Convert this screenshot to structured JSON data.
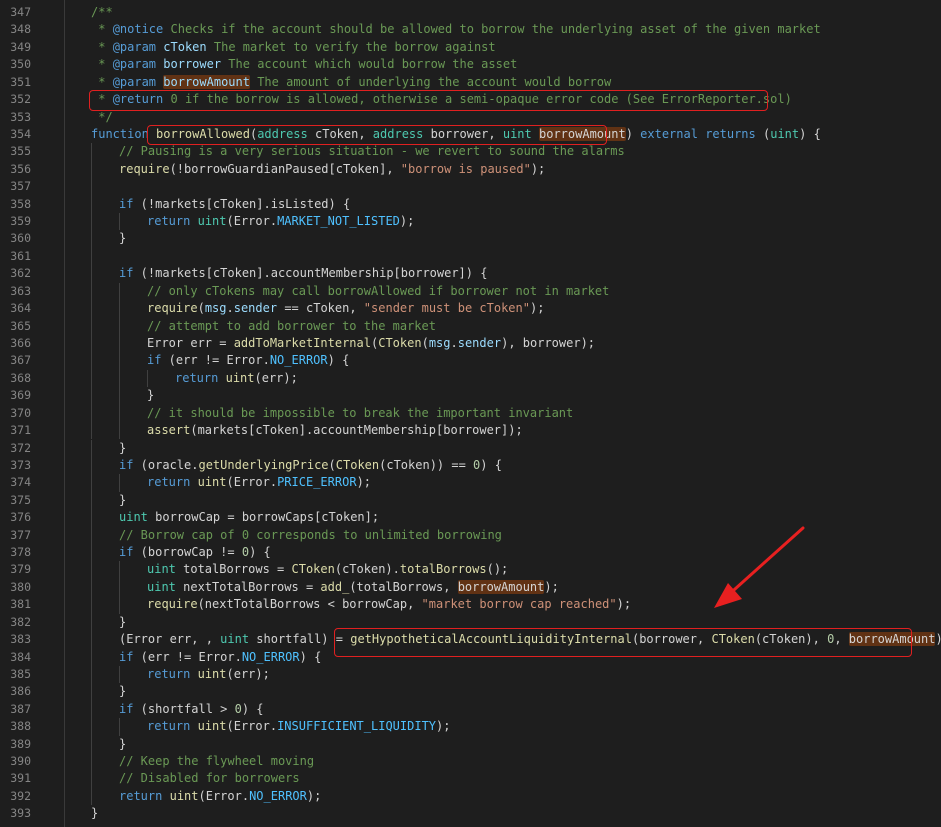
{
  "editor": {
    "lines": [
      {
        "n": "347",
        "indent": 0,
        "tokens": [
          [
            "/**",
            "cm"
          ]
        ]
      },
      {
        "n": "348",
        "indent": 0,
        "tokens": [
          [
            " * ",
            "cm"
          ],
          [
            "@notice",
            "tg"
          ],
          [
            " Checks if the account should be allowed to borrow the underlying asset of the given market",
            "cm"
          ]
        ]
      },
      {
        "n": "349",
        "indent": 0,
        "tokens": [
          [
            " * ",
            "cm"
          ],
          [
            "@param",
            "tg"
          ],
          [
            " ",
            "cm"
          ],
          [
            "cToken",
            "va"
          ],
          [
            " The market to verify the borrow against",
            "cm"
          ]
        ]
      },
      {
        "n": "350",
        "indent": 0,
        "tokens": [
          [
            " * ",
            "cm"
          ],
          [
            "@param",
            "tg"
          ],
          [
            " ",
            "cm"
          ],
          [
            "borrower",
            "va"
          ],
          [
            " The account which would borrow the asset",
            "cm"
          ]
        ]
      },
      {
        "n": "351",
        "indent": 0,
        "tokens": [
          [
            " * ",
            "cm"
          ],
          [
            "@param",
            "tg"
          ],
          [
            " ",
            "cm"
          ],
          [
            "borrowAmount",
            "va hl"
          ],
          [
            " The amount of underlying the account would borrow",
            "cm"
          ]
        ]
      },
      {
        "n": "352",
        "indent": 0,
        "tokens": [
          [
            " * ",
            "cm"
          ],
          [
            "@return",
            "tg"
          ],
          [
            " 0 if the borrow is allowed, otherwise a semi-opaque error code (See ErrorReporter.sol)",
            "cm"
          ]
        ]
      },
      {
        "n": "353",
        "indent": 0,
        "tokens": [
          [
            " */",
            "cm"
          ]
        ]
      },
      {
        "n": "354",
        "indent": 0,
        "tokens": [
          [
            "function ",
            "kw"
          ],
          [
            "borrowAllowed",
            "fn"
          ],
          [
            "(",
            ""
          ],
          [
            "address",
            "ty"
          ],
          [
            " cToken, ",
            ""
          ],
          [
            "address",
            "ty"
          ],
          [
            " borrower, ",
            ""
          ],
          [
            "uint",
            "ty"
          ],
          [
            " ",
            ""
          ],
          [
            "borrowAmount",
            "hl"
          ],
          [
            ") ",
            ""
          ],
          [
            "external",
            "kw"
          ],
          [
            " ",
            ""
          ],
          [
            "returns",
            "kw"
          ],
          [
            " (",
            ""
          ],
          [
            "uint",
            "ty"
          ],
          [
            ") {",
            ""
          ]
        ]
      },
      {
        "n": "355",
        "indent": 1,
        "tokens": [
          [
            "// Pausing is a very serious situation - we revert to sound the alarms",
            "cm"
          ]
        ]
      },
      {
        "n": "356",
        "indent": 1,
        "tokens": [
          [
            "require",
            "fn"
          ],
          [
            "(!borrowGuardianPaused[cToken], ",
            ""
          ],
          [
            "\"borrow is paused\"",
            "st"
          ],
          [
            ");",
            ""
          ]
        ]
      },
      {
        "n": "357",
        "indent": 1,
        "tokens": []
      },
      {
        "n": "358",
        "indent": 1,
        "tokens": [
          [
            "if",
            "kw"
          ],
          [
            " (!markets[cToken].isListed) {",
            ""
          ]
        ]
      },
      {
        "n": "359",
        "indent": 2,
        "tokens": [
          [
            "return",
            "kw"
          ],
          [
            " ",
            ""
          ],
          [
            "uint",
            "ty"
          ],
          [
            "(Error.",
            ""
          ],
          [
            "MARKET_NOT_LISTED",
            "cn"
          ],
          [
            ");",
            ""
          ]
        ]
      },
      {
        "n": "360",
        "indent": 1,
        "tokens": [
          [
            "}",
            ""
          ]
        ]
      },
      {
        "n": "361",
        "indent": 1,
        "tokens": []
      },
      {
        "n": "362",
        "indent": 1,
        "tokens": [
          [
            "if",
            "kw"
          ],
          [
            " (!markets[cToken].accountMembership[borrower]) {",
            ""
          ]
        ]
      },
      {
        "n": "363",
        "indent": 2,
        "tokens": [
          [
            "// only cTokens may call borrowAllowed if borrower not in market",
            "cm"
          ]
        ]
      },
      {
        "n": "364",
        "indent": 2,
        "tokens": [
          [
            "require",
            "fn"
          ],
          [
            "(",
            ""
          ],
          [
            "msg",
            "va"
          ],
          [
            ".",
            ""
          ],
          [
            "sender",
            "va"
          ],
          [
            " == cToken, ",
            ""
          ],
          [
            "\"sender must be cToken\"",
            "st"
          ],
          [
            ");",
            ""
          ]
        ]
      },
      {
        "n": "365",
        "indent": 2,
        "tokens": [
          [
            "// attempt to add borrower to the market",
            "cm"
          ]
        ]
      },
      {
        "n": "366",
        "indent": 2,
        "tokens": [
          [
            "Error err = ",
            ""
          ],
          [
            "addToMarketInternal",
            "fn"
          ],
          [
            "(",
            ""
          ],
          [
            "CToken",
            "fn"
          ],
          [
            "(",
            ""
          ],
          [
            "msg",
            "va"
          ],
          [
            ".",
            ""
          ],
          [
            "sender",
            "va"
          ],
          [
            "), borrower);",
            ""
          ]
        ]
      },
      {
        "n": "367",
        "indent": 2,
        "tokens": [
          [
            "if",
            "kw"
          ],
          [
            " (err != Error.",
            ""
          ],
          [
            "NO_ERROR",
            "cn"
          ],
          [
            ") {",
            ""
          ]
        ]
      },
      {
        "n": "368",
        "indent": 3,
        "tokens": [
          [
            "return",
            "kw"
          ],
          [
            " ",
            ""
          ],
          [
            "uint",
            "fn"
          ],
          [
            "(err);",
            ""
          ]
        ]
      },
      {
        "n": "369",
        "indent": 2,
        "tokens": [
          [
            "}",
            ""
          ]
        ]
      },
      {
        "n": "370",
        "indent": 2,
        "tokens": [
          [
            "// it should be impossible to break the important invariant",
            "cm"
          ]
        ]
      },
      {
        "n": "371",
        "indent": 2,
        "tokens": [
          [
            "assert",
            "fn"
          ],
          [
            "(markets[cToken].accountMembership[borrower]);",
            ""
          ]
        ]
      },
      {
        "n": "372",
        "indent": 1,
        "tokens": [
          [
            "}",
            ""
          ]
        ]
      },
      {
        "n": "373",
        "indent": 1,
        "tokens": [
          [
            "if",
            "kw"
          ],
          [
            " (oracle.",
            ""
          ],
          [
            "getUnderlyingPrice",
            "fn"
          ],
          [
            "(",
            ""
          ],
          [
            "CToken",
            "fn"
          ],
          [
            "(cToken)) == ",
            ""
          ],
          [
            "0",
            "nm"
          ],
          [
            ") {",
            ""
          ]
        ]
      },
      {
        "n": "374",
        "indent": 2,
        "tokens": [
          [
            "return",
            "kw"
          ],
          [
            " ",
            ""
          ],
          [
            "uint",
            "fn"
          ],
          [
            "(Error.",
            ""
          ],
          [
            "PRICE_ERROR",
            "cn"
          ],
          [
            ");",
            ""
          ]
        ]
      },
      {
        "n": "375",
        "indent": 1,
        "tokens": [
          [
            "}",
            ""
          ]
        ]
      },
      {
        "n": "376",
        "indent": 1,
        "tokens": [
          [
            "uint",
            "ty"
          ],
          [
            " borrowCap = borrowCaps[cToken];",
            ""
          ]
        ]
      },
      {
        "n": "377",
        "indent": 1,
        "tokens": [
          [
            "// Borrow cap of 0 corresponds to unlimited borrowing",
            "cm"
          ]
        ]
      },
      {
        "n": "378",
        "indent": 1,
        "tokens": [
          [
            "if",
            "kw"
          ],
          [
            " (borrowCap != ",
            ""
          ],
          [
            "0",
            "nm"
          ],
          [
            ") {",
            ""
          ]
        ]
      },
      {
        "n": "379",
        "indent": 2,
        "tokens": [
          [
            "uint",
            "ty"
          ],
          [
            " totalBorrows = ",
            ""
          ],
          [
            "CToken",
            "fn"
          ],
          [
            "(cToken).",
            ""
          ],
          [
            "totalBorrows",
            "fn"
          ],
          [
            "();",
            ""
          ]
        ]
      },
      {
        "n": "380",
        "indent": 2,
        "tokens": [
          [
            "uint",
            "ty"
          ],
          [
            " nextTotalBorrows = ",
            ""
          ],
          [
            "add_",
            "fn"
          ],
          [
            "(totalBorrows, ",
            ""
          ],
          [
            "borrowAmount",
            "hl"
          ],
          [
            ");",
            ""
          ]
        ]
      },
      {
        "n": "381",
        "indent": 2,
        "tokens": [
          [
            "require",
            "fn"
          ],
          [
            "(nextTotalBorrows < borrowCap, ",
            ""
          ],
          [
            "\"market borrow cap reached\"",
            "st"
          ],
          [
            ");",
            ""
          ]
        ]
      },
      {
        "n": "382",
        "indent": 1,
        "tokens": [
          [
            "}",
            ""
          ]
        ]
      },
      {
        "n": "383",
        "indent": 1,
        "tokens": [
          [
            "(Error err, , ",
            ""
          ],
          [
            "uint",
            "ty"
          ],
          [
            " shortfall) = ",
            ""
          ],
          [
            "getHypotheticalAccountLiquidityInternal",
            "fn"
          ],
          [
            "(borrower, ",
            ""
          ],
          [
            "CToken",
            "fn"
          ],
          [
            "(cToken), ",
            ""
          ],
          [
            "0",
            "nm"
          ],
          [
            ", ",
            ""
          ],
          [
            "borrowAmount",
            "hl"
          ],
          [
            ");",
            ""
          ]
        ]
      },
      {
        "n": "384",
        "indent": 1,
        "tokens": [
          [
            "if",
            "kw"
          ],
          [
            " (err != Error.",
            ""
          ],
          [
            "NO_ERROR",
            "cn"
          ],
          [
            ") {",
            ""
          ]
        ]
      },
      {
        "n": "385",
        "indent": 2,
        "tokens": [
          [
            "return",
            "kw"
          ],
          [
            " ",
            ""
          ],
          [
            "uint",
            "fn"
          ],
          [
            "(err);",
            ""
          ]
        ]
      },
      {
        "n": "386",
        "indent": 1,
        "tokens": [
          [
            "}",
            ""
          ]
        ]
      },
      {
        "n": "387",
        "indent": 1,
        "tokens": [
          [
            "if",
            "kw"
          ],
          [
            " (shortfall > ",
            ""
          ],
          [
            "0",
            "nm"
          ],
          [
            ") {",
            ""
          ]
        ]
      },
      {
        "n": "388",
        "indent": 2,
        "tokens": [
          [
            "return",
            "kw"
          ],
          [
            " ",
            ""
          ],
          [
            "uint",
            "fn"
          ],
          [
            "(Error.",
            ""
          ],
          [
            "INSUFFICIENT_LIQUIDITY",
            "cn"
          ],
          [
            ");",
            ""
          ]
        ]
      },
      {
        "n": "389",
        "indent": 1,
        "tokens": [
          [
            "}",
            ""
          ]
        ]
      },
      {
        "n": "390",
        "indent": 1,
        "tokens": [
          [
            "// Keep the flywheel moving",
            "cm"
          ]
        ]
      },
      {
        "n": "391",
        "indent": 1,
        "tokens": [
          [
            "// Disabled for borrowers",
            "cm"
          ]
        ]
      },
      {
        "n": "392",
        "indent": 1,
        "tokens": [
          [
            "return",
            "kw"
          ],
          [
            " ",
            ""
          ],
          [
            "uint",
            "fn"
          ],
          [
            "(Error.",
            ""
          ],
          [
            "NO_ERROR",
            "cn"
          ],
          [
            ");",
            ""
          ]
        ]
      },
      {
        "n": "393",
        "indent": 0,
        "tokens": [
          [
            "}",
            ""
          ]
        ]
      }
    ]
  },
  "annotations": {
    "box_color": "#e02020",
    "arrow_color": "#e82020",
    "boxes": [
      {
        "line": "352",
        "label": "return-doc"
      },
      {
        "line": "354",
        "label": "borrow-allowed-signature"
      },
      {
        "line": "383",
        "label": "hypothetical-liquidity-call"
      }
    ]
  }
}
